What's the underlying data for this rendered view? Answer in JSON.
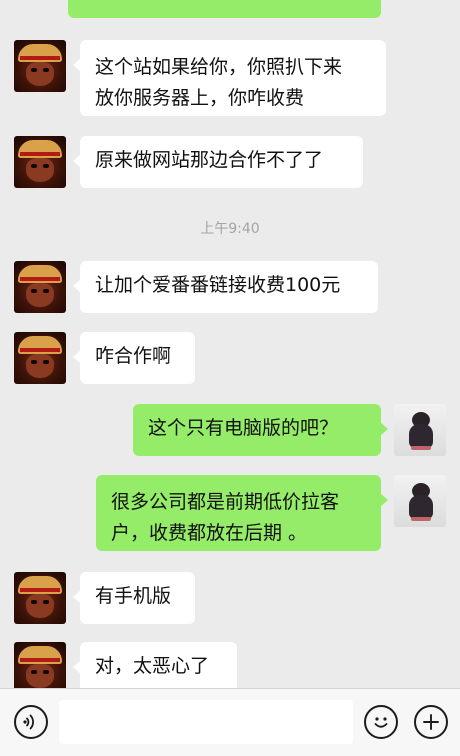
{
  "messages": [
    {
      "side": "left",
      "lines": [
        "这个站如果给你，你照扒下来",
        "放你服务器上，你咋收费"
      ]
    },
    {
      "side": "left",
      "lines": [
        "原来做网站那边合作不了了"
      ]
    },
    {
      "side": "left",
      "lines": [
        "让加个爱番番链接收费100元"
      ]
    },
    {
      "side": "left",
      "lines": [
        "咋合作啊"
      ]
    },
    {
      "side": "right",
      "lines": [
        "这个只有电脑版的吧？"
      ]
    },
    {
      "side": "right",
      "lines": [
        "很多公司都是前期低价拉客",
        "户，收费都放在后期 。"
      ]
    },
    {
      "side": "left",
      "lines": [
        "有手机版"
      ]
    },
    {
      "side": "left",
      "lines": [
        "对，太恶心了"
      ]
    }
  ],
  "timestamp": "上午9:40",
  "input_bar": {
    "text_value": "",
    "voice_icon": "voice-icon",
    "emoji_icon": "emoji-icon",
    "plus_icon": "plus-icon"
  },
  "colors": {
    "background": "#ebebeb",
    "bubble_incoming": "#ffffff",
    "bubble_outgoing": "#95ec69",
    "timestamp_text": "#a4a4a4"
  }
}
